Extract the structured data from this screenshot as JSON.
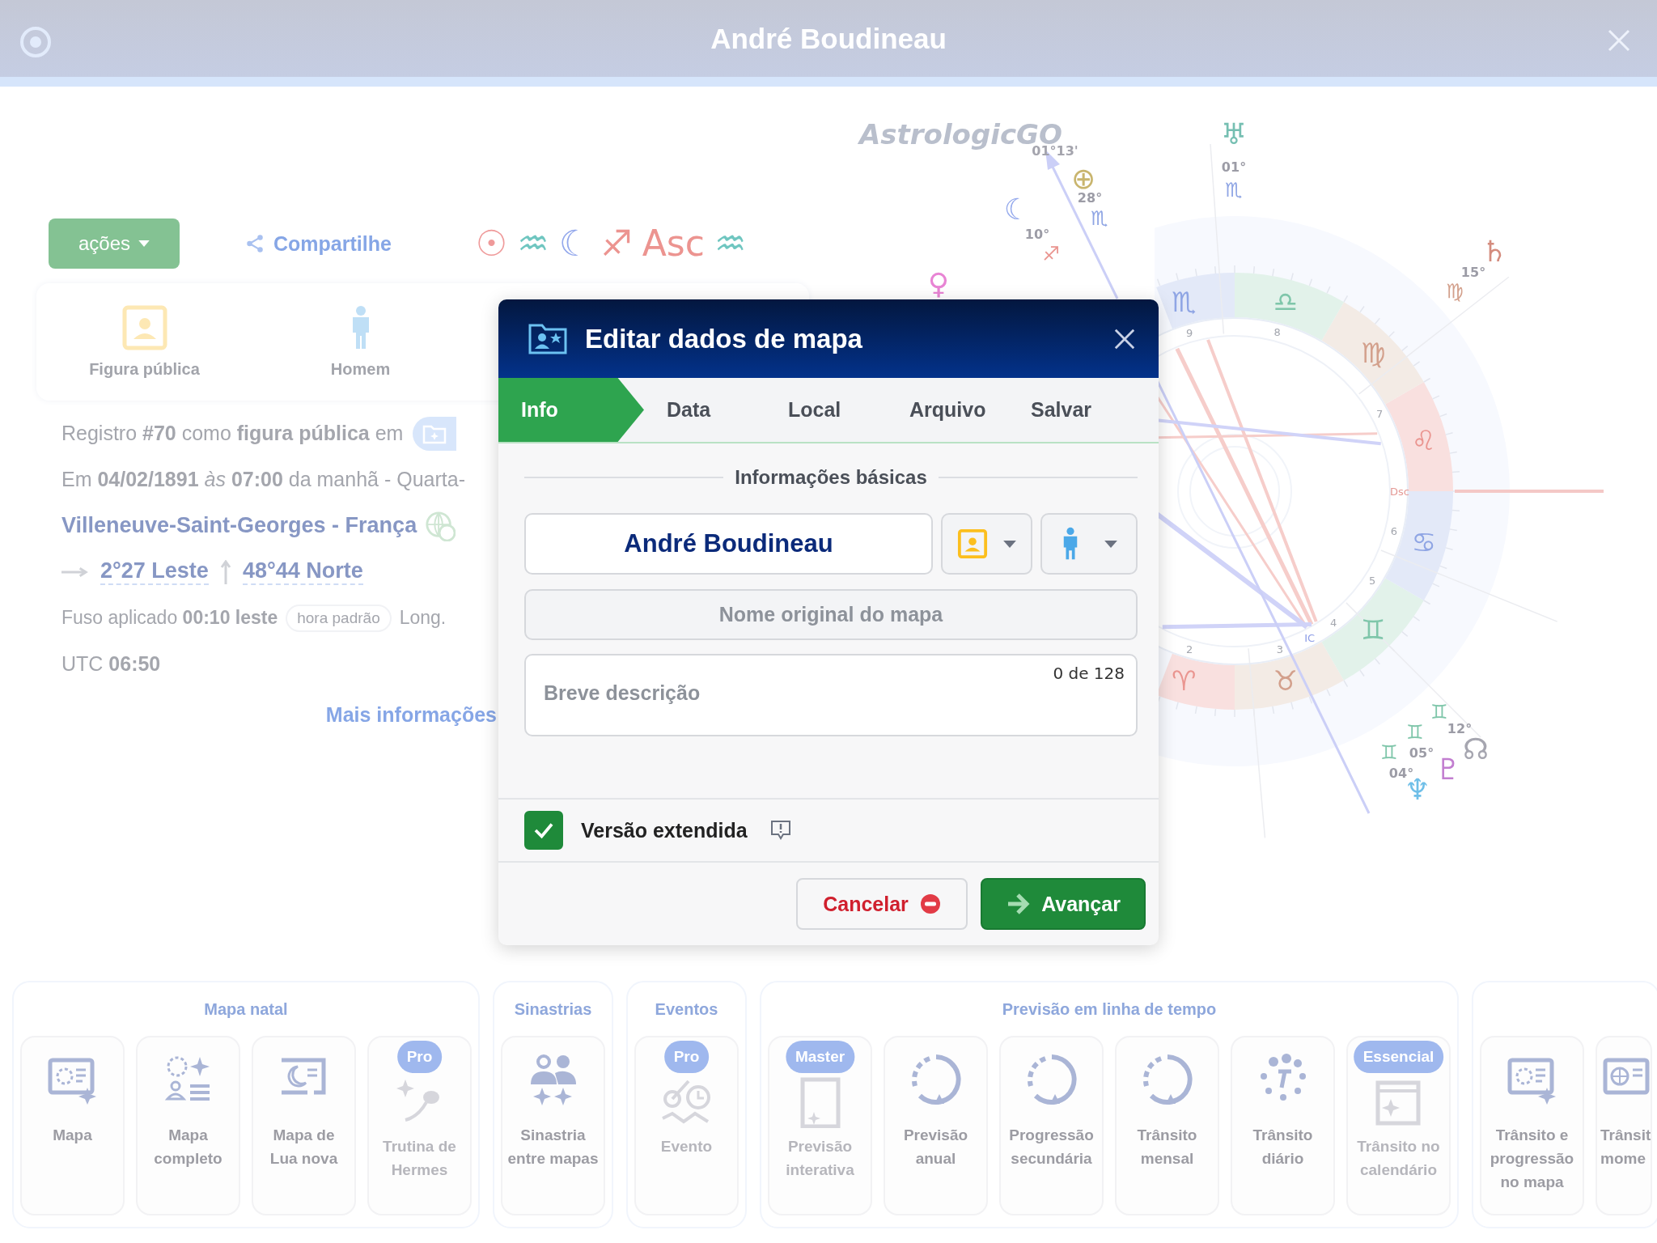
{
  "header": {
    "title": "André Boudineau"
  },
  "actions_button": "ações",
  "share_link": "Compartilhe",
  "placements": [
    {
      "glyph": "☉",
      "color": "#ef9a9a"
    },
    {
      "glyph": "♒",
      "color": "#6fc6c0"
    },
    {
      "glyph": "☾",
      "color": "#93a8ec"
    },
    {
      "glyph": "♐",
      "color": "#ec9490"
    },
    {
      "glyph": "Asc",
      "color": "#ec9490"
    },
    {
      "glyph": "♒",
      "color": "#6fc6c0"
    }
  ],
  "profile": [
    {
      "kind": "public",
      "label": "Figura pública"
    },
    {
      "kind": "man",
      "label": "Homem"
    }
  ],
  "details": {
    "record": "Registro **#70** como **figura pública** em",
    "datetime": "Em **04/02/1891** *às* **07:00** da manhã - Quarta-",
    "place": "Villeneuve-Saint-Georges - França",
    "longitude": "2°27 Leste",
    "latitude": "48°44 Norte",
    "timezone": "Fuso aplicado **00:10 leste**",
    "tz_tag": "hora padrão",
    "long_cut": "Long.",
    "utc": "UTC **06:50**",
    "more_link": "Mais informações"
  },
  "chart_wheel": {
    "logo": "AstrologicGO",
    "signs": [
      {
        "glyph": "♏",
        "color": "#8fa5e4"
      },
      {
        "glyph": "♎",
        "color": "#7fc6aa"
      },
      {
        "glyph": "♍",
        "color": "#d3a08c"
      },
      {
        "glyph": "♌",
        "color": "#ea9590"
      },
      {
        "glyph": "♋",
        "color": "#8fa5e4"
      },
      {
        "glyph": "♊",
        "color": "#7fc6aa"
      },
      {
        "glyph": "♉",
        "color": "#d3a08c"
      },
      {
        "glyph": "♈",
        "color": "#ea9590"
      }
    ],
    "houses": [
      "9",
      "8",
      "7",
      "6",
      "5",
      "4",
      "3",
      "2"
    ],
    "angles": [
      "Dsc",
      "IC"
    ],
    "labels": [
      {
        "kind": "planet",
        "text": "♅",
        "color": "#76bfb2"
      },
      {
        "kind": "degree",
        "text": "01°",
        "color": "#9c9ca6"
      },
      {
        "kind": "sign",
        "text": "♏",
        "color": "#8fa5e4"
      },
      {
        "kind": "degree",
        "text": "01°13'",
        "color": "#a4a4ad"
      },
      {
        "kind": "planet",
        "text": "⊕",
        "color": "#c9b56e"
      },
      {
        "kind": "degree",
        "text": "28°",
        "color": "#9c9ca6"
      },
      {
        "kind": "sign",
        "text": "♏",
        "color": "#8fa5e4"
      },
      {
        "kind": "planet",
        "text": "☾",
        "color": "#93a8ec"
      },
      {
        "kind": "degree",
        "text": "10°",
        "color": "#9c9ca6"
      },
      {
        "kind": "sign",
        "text": "♐",
        "color": "#ea9590"
      },
      {
        "kind": "planet",
        "text": "♀",
        "color": "#e884d4"
      },
      {
        "kind": "planet",
        "text": "♄",
        "color": "#d48c7e"
      },
      {
        "kind": "degree",
        "text": "15°",
        "color": "#9c9ca6"
      },
      {
        "kind": "sign",
        "text": "♍",
        "color": "#d3a08c"
      },
      {
        "kind": "sign",
        "text": "♊",
        "color": "#7fc6aa"
      },
      {
        "kind": "degree",
        "text": "12°",
        "color": "#9c9ca6"
      },
      {
        "kind": "planet",
        "text": "☊",
        "color": "#a6a6b0"
      },
      {
        "kind": "sign",
        "text": "♊",
        "color": "#7fc6aa"
      },
      {
        "kind": "degree",
        "text": "05°",
        "color": "#9c9ca6"
      },
      {
        "kind": "planet",
        "text": "♇",
        "color": "#c27ed0"
      },
      {
        "kind": "sign",
        "text": "♊",
        "color": "#7fc6aa"
      },
      {
        "kind": "degree",
        "text": "04°",
        "color": "#9c9ca6"
      },
      {
        "kind": "planet",
        "text": "♆",
        "color": "#6fbfe8"
      }
    ]
  },
  "dialog": {
    "title": "Editar dados de mapa",
    "tabs": [
      {
        "label": "Info",
        "selected": true
      },
      {
        "label": "Data",
        "selected": false
      },
      {
        "label": "Local",
        "selected": false
      },
      {
        "label": "Arquivo",
        "selected": false
      },
      {
        "label": "Salvar",
        "selected": false
      }
    ],
    "section": "Informações básicas",
    "name_value": "André Boudineau",
    "original_name_placeholder": "Nome original do mapa",
    "description_placeholder": "Breve descrição",
    "counter": "0 de 128",
    "extended": {
      "label": "Versão extendida",
      "checked": true
    },
    "cancel": "Cancelar",
    "next": "Avançar"
  },
  "tool_groups": [
    {
      "title": "Mapa natal",
      "tools": [
        {
          "label": "Mapa",
          "kind": "chart",
          "disabled": false
        },
        {
          "label": "Mapa completo",
          "kind": "full",
          "disabled": false
        },
        {
          "label": "Mapa de Lua nova",
          "kind": "moon",
          "disabled": false
        },
        {
          "label": "Trutina de Hermes",
          "kind": "seed",
          "disabled": true,
          "badge": "Pro"
        }
      ]
    },
    {
      "title": "Sinastrias",
      "tools": [
        {
          "label": "Sinastria entre mapas",
          "kind": "people",
          "disabled": false
        }
      ]
    },
    {
      "title": "Eventos",
      "tools": [
        {
          "label": "Evento",
          "kind": "event",
          "disabled": true,
          "badge": "Pro"
        }
      ]
    },
    {
      "title": "Previsão em linha de tempo",
      "tools": [
        {
          "label": "Previsão interativa",
          "kind": "doc",
          "disabled": true,
          "badge": "Master"
        },
        {
          "label": "Previsão anual",
          "kind": "cycle",
          "disabled": false
        },
        {
          "label": "Progressão secundária",
          "kind": "cycle",
          "disabled": false
        },
        {
          "label": "Trânsito mensal",
          "kind": "cycle",
          "disabled": false
        },
        {
          "label": "Trânsito diário",
          "kind": "dots",
          "disabled": false
        },
        {
          "label": "Trânsito no calendário",
          "kind": "calendar",
          "disabled": true,
          "badge": "Essencial"
        }
      ]
    },
    {
      "tools": [
        {
          "label": "Trânsito e progressão no mapa",
          "kind": "chart",
          "disabled": false
        },
        {
          "label": "Trânsit mome",
          "kind": "globe",
          "disabled": false
        }
      ]
    }
  ]
}
